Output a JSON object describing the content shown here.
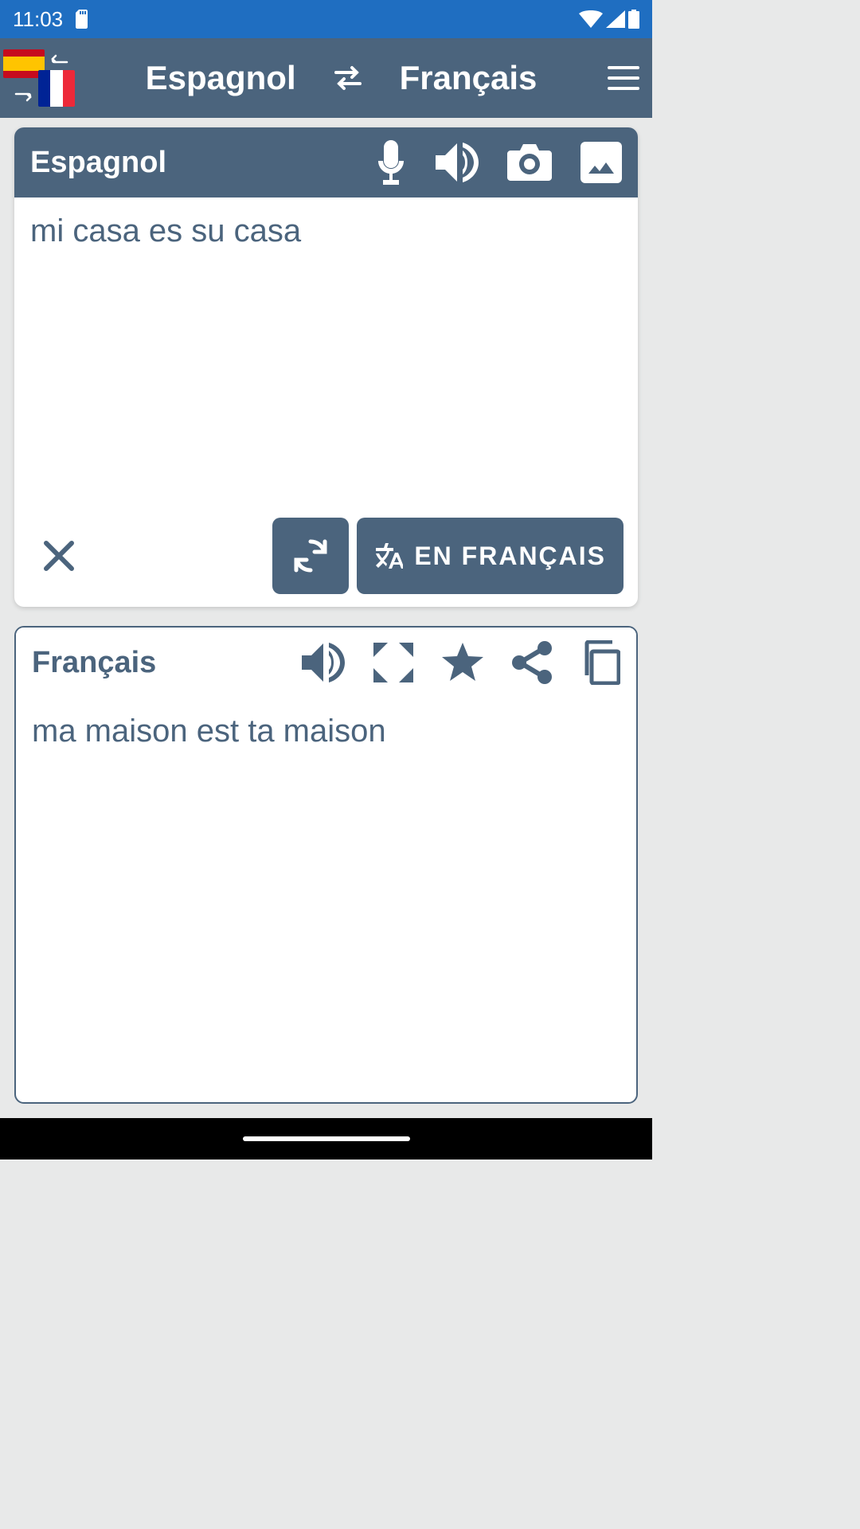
{
  "status": {
    "time": "11:03"
  },
  "header": {
    "source_lang": "Espagnol",
    "target_lang": "Français"
  },
  "source_card": {
    "label": "Espagnol",
    "text": "mi casa es su casa",
    "translate_button": "EN FRANÇAIS"
  },
  "target_card": {
    "label": "Français",
    "text": "ma maison est ta maison"
  }
}
